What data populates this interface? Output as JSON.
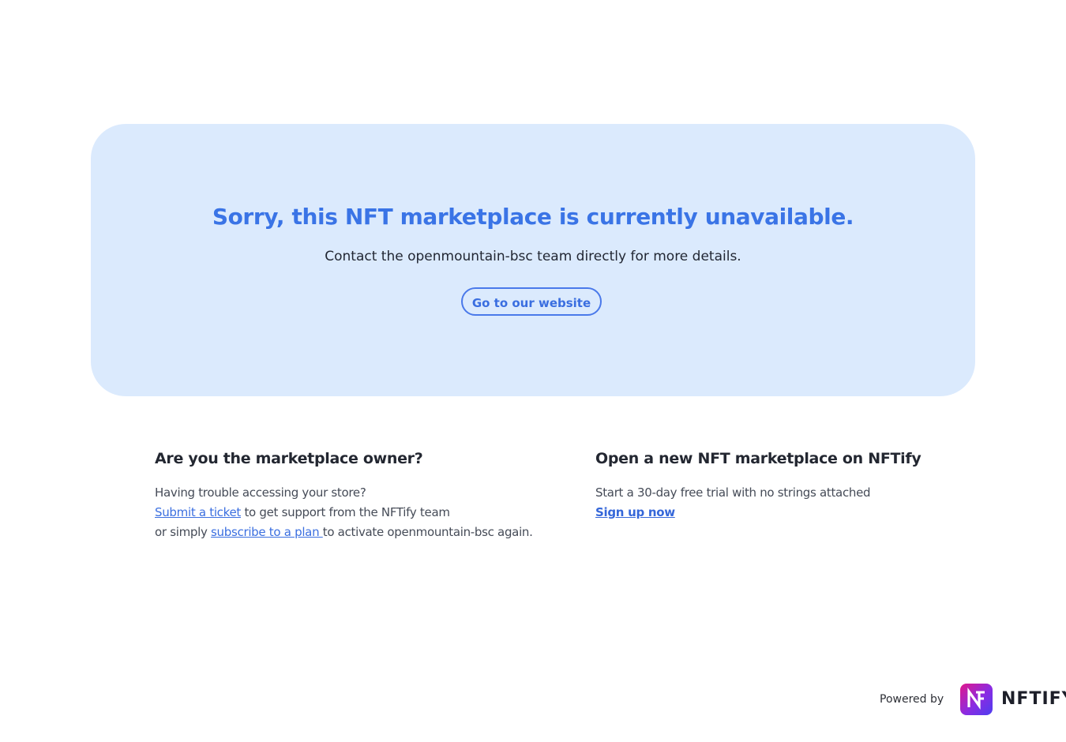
{
  "hero": {
    "title": "Sorry, this NFT marketplace is currently unavailable.",
    "subtitle": "Contact the openmountain-bsc team directly for more details.",
    "button_label": "Go to our website"
  },
  "owner_section": {
    "heading": "Are you the marketplace owner?",
    "line1": "Having trouble accessing your store?",
    "ticket_link": "Submit a ticket",
    "line2_rest": " to get support from the NFTify team",
    "line3_prefix": "or simply ",
    "plan_link": "subscribe to a plan ",
    "line3_rest": "to activate openmountain-bsc again."
  },
  "new_section": {
    "heading": "Open a new NFT marketplace on NFTify",
    "line1": "Start a 30-day free trial with no strings attached",
    "signup_link": "Sign up now"
  },
  "footer": {
    "powered_by": "Powered by",
    "logo_icon": "nftify-logo-icon",
    "brand": "NFTIFY"
  },
  "colors": {
    "hero_bg": "#dbeafd",
    "accent": "#3a74e6",
    "text_dark": "#232731",
    "text_body": "#454b57"
  }
}
